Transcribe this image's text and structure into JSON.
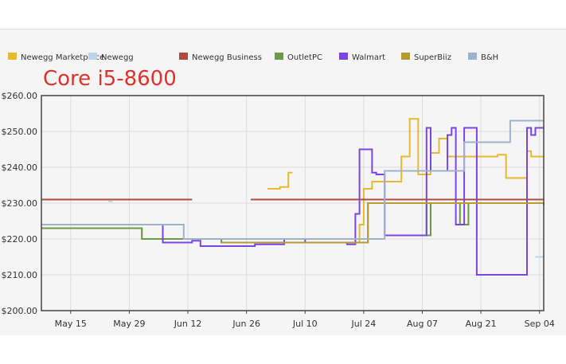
{
  "chart_data": {
    "type": "line",
    "title": "Core i5-8600",
    "xlabel": "",
    "ylabel": "",
    "x_ticks": [
      "May 15",
      "May 29",
      "Jun 12",
      "Jun 26",
      "Jul 10",
      "Jul 24",
      "Aug 07",
      "Aug 21",
      "Sep 04"
    ],
    "y_ticks": [
      "$200.00",
      "$210.00",
      "$220.00",
      "$230.00",
      "$240.00",
      "$250.00",
      "$260.00"
    ],
    "xlim": [
      "2018-05-08",
      "2018-09-05"
    ],
    "ylim": [
      200,
      260
    ],
    "grid": true,
    "legend_position": "top",
    "step": true,
    "series": [
      {
        "name": "Newegg Marketplace",
        "color": "#e6b92e",
        "segments": [
          [
            [
              "2018-05-08",
              223
            ],
            [
              "2018-06-01",
              220
            ],
            [
              "2018-06-20",
              219
            ],
            [
              "2018-07-22",
              219
            ],
            [
              "2018-07-23",
              224
            ],
            [
              "2018-07-24",
              234
            ],
            [
              "2018-07-26",
              236
            ],
            [
              "2018-08-02",
              243
            ],
            [
              "2018-08-04",
              253.5
            ],
            [
              "2018-08-06",
              238
            ],
            [
              "2018-08-09",
              244
            ],
            [
              "2018-08-11",
              248
            ],
            [
              "2018-08-13",
              243
            ],
            [
              "2018-08-25",
              243.5
            ],
            [
              "2018-08-27",
              237
            ],
            [
              "2018-09-01",
              244.5
            ],
            [
              "2018-09-02",
              243
            ],
            [
              "2018-09-05",
              243
            ]
          ],
          [
            [
              "2018-07-01",
              234
            ],
            [
              "2018-07-04",
              234.5
            ],
            [
              "2018-07-06",
              238.5
            ],
            [
              "2018-07-07",
              238.5
            ]
          ]
        ]
      },
      {
        "name": "Newegg",
        "color": "#bcd4ee",
        "segments": [
          [
            [
              "2018-05-24",
              230.5
            ],
            [
              "2018-05-25",
              230.5
            ]
          ],
          [
            [
              "2018-09-03",
              215
            ],
            [
              "2018-09-05",
              215
            ]
          ]
        ]
      },
      {
        "name": "Newegg Business",
        "color": "#b24a3f",
        "segments": [
          [
            [
              "2018-05-08",
              231
            ],
            [
              "2018-06-13",
              231
            ]
          ],
          [
            [
              "2018-06-27",
              231
            ],
            [
              "2018-09-05",
              231
            ]
          ]
        ]
      },
      {
        "name": "OutletPC",
        "color": "#6a9a42",
        "segments": [
          [
            [
              "2018-05-08",
              223
            ],
            [
              "2018-06-01",
              220
            ],
            [
              "2018-06-20",
              219
            ],
            [
              "2018-07-22",
              219
            ],
            [
              "2018-07-25",
              230
            ],
            [
              "2018-08-08",
              221
            ],
            [
              "2018-08-09",
              230
            ],
            [
              "2018-08-16",
              224
            ],
            [
              "2018-08-18",
              230
            ],
            [
              "2018-09-05",
              230
            ]
          ]
        ]
      },
      {
        "name": "Walmart",
        "color": "#7b45e0",
        "segments": [
          [
            [
              "2018-05-08",
              224
            ],
            [
              "2018-06-06",
              219
            ],
            [
              "2018-06-13",
              219.5
            ],
            [
              "2018-06-15",
              218
            ],
            [
              "2018-06-24",
              218
            ],
            [
              "2018-06-28",
              218.5
            ],
            [
              "2018-07-05",
              220
            ],
            [
              "2018-07-10",
              219
            ],
            [
              "2018-07-20",
              218.5
            ],
            [
              "2018-07-22",
              227
            ],
            [
              "2018-07-23",
              245
            ],
            [
              "2018-07-26",
              238.5
            ],
            [
              "2018-07-27",
              238
            ],
            [
              "2018-07-29",
              221
            ],
            [
              "2018-08-08",
              251
            ],
            [
              "2018-08-09",
              239
            ],
            [
              "2018-08-13",
              249
            ],
            [
              "2018-08-14",
              251
            ],
            [
              "2018-08-15",
              224
            ],
            [
              "2018-08-17",
              251
            ],
            [
              "2018-08-20",
              210
            ],
            [
              "2018-09-01",
              251
            ],
            [
              "2018-09-02",
              249
            ],
            [
              "2018-09-03",
              251
            ],
            [
              "2018-09-05",
              251
            ]
          ]
        ]
      },
      {
        "name": "SuperBiiz",
        "color": "#b59b34",
        "segments": [
          [
            [
              "2018-06-20",
              219
            ],
            [
              "2018-07-22",
              219
            ],
            [
              "2018-07-25",
              230
            ],
            [
              "2018-09-05",
              229.5
            ]
          ]
        ]
      },
      {
        "name": "B&H",
        "color": "#9fb2cb",
        "segments": [
          [
            [
              "2018-05-08",
              224
            ],
            [
              "2018-06-11",
              220
            ],
            [
              "2018-07-28",
              220
            ],
            [
              "2018-07-29",
              239
            ],
            [
              "2018-08-13",
              239
            ],
            [
              "2018-08-17",
              247
            ],
            [
              "2018-08-28",
              253
            ],
            [
              "2018-09-05",
              253
            ]
          ]
        ]
      }
    ]
  }
}
